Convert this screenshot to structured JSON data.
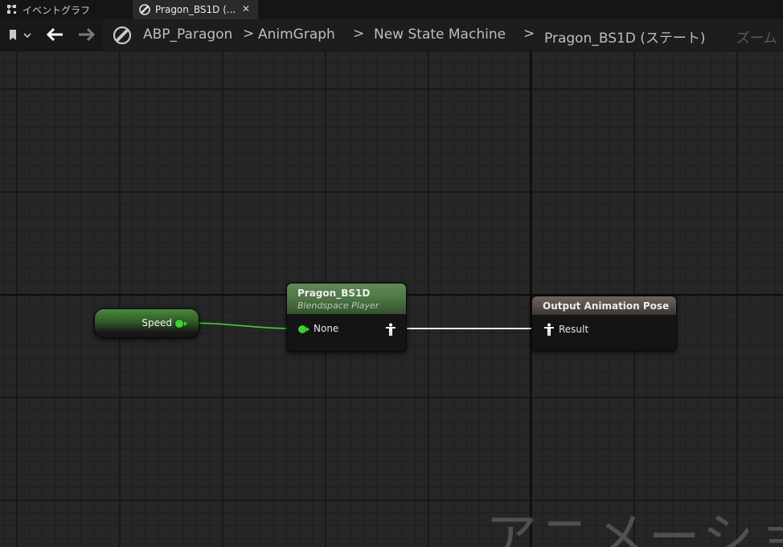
{
  "tabs": [
    {
      "label": "イベントグラフ",
      "icon": "event-graph-icon"
    },
    {
      "label": "Pragon_BS1D (...",
      "icon": "state-icon"
    }
  ],
  "toolbar": {
    "bookmark_icon": "bookmark-icon",
    "back_icon": "arrow-left-icon",
    "forward_icon": "arrow-right-icon",
    "graph_icon": "state-icon"
  },
  "breadcrumb": {
    "items": [
      "ABP_Paragon",
      "AnimGraph",
      "New State Machine",
      "Pragon_BS1D (ステート)"
    ],
    "separator": ">",
    "zoom_label": "ズーム"
  },
  "nodes": {
    "speed": {
      "label": "Speed"
    },
    "blendspace": {
      "title": "Pragon_BS1D",
      "subtitle": "Blendspace Player",
      "input_pin": "None"
    },
    "output": {
      "title": "Output Animation Pose",
      "input_pin": "Result"
    }
  },
  "watermark": "アニメーション",
  "colors": {
    "float_pin": "#35d62a",
    "blendspace_header": "#4f7846",
    "output_header": "#544a46",
    "canvas": "#262626"
  }
}
